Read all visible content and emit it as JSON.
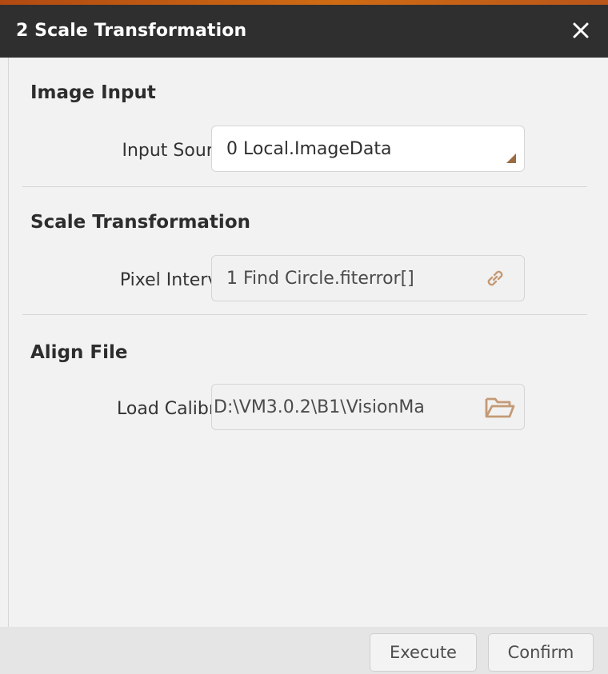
{
  "window": {
    "title": "2 Scale Transformation",
    "close_icon": "close-icon"
  },
  "sections": [
    {
      "title": "Image Input",
      "field": {
        "label": "Input Source",
        "value": "0 Local.ImageData",
        "icon": "dropdown-corner-icon"
      }
    },
    {
      "title": "Scale Transformation",
      "field": {
        "label": "Pixel Interval",
        "value": "1 Find Circle.fiterror[]",
        "icon": "link-icon"
      }
    },
    {
      "title": "Align File",
      "field": {
        "label": "Load Calibrat",
        "value": "D:\\VM3.0.2\\B1\\VisionMa",
        "icon": "folder-icon"
      }
    }
  ],
  "footer": {
    "execute_label": "Execute",
    "confirm_label": "Confirm"
  },
  "colors": {
    "titlebar": "#2f2f2f",
    "accent": "#cf6b14",
    "icon_tint": "#c49a75",
    "panel": "#f2f2f2"
  }
}
